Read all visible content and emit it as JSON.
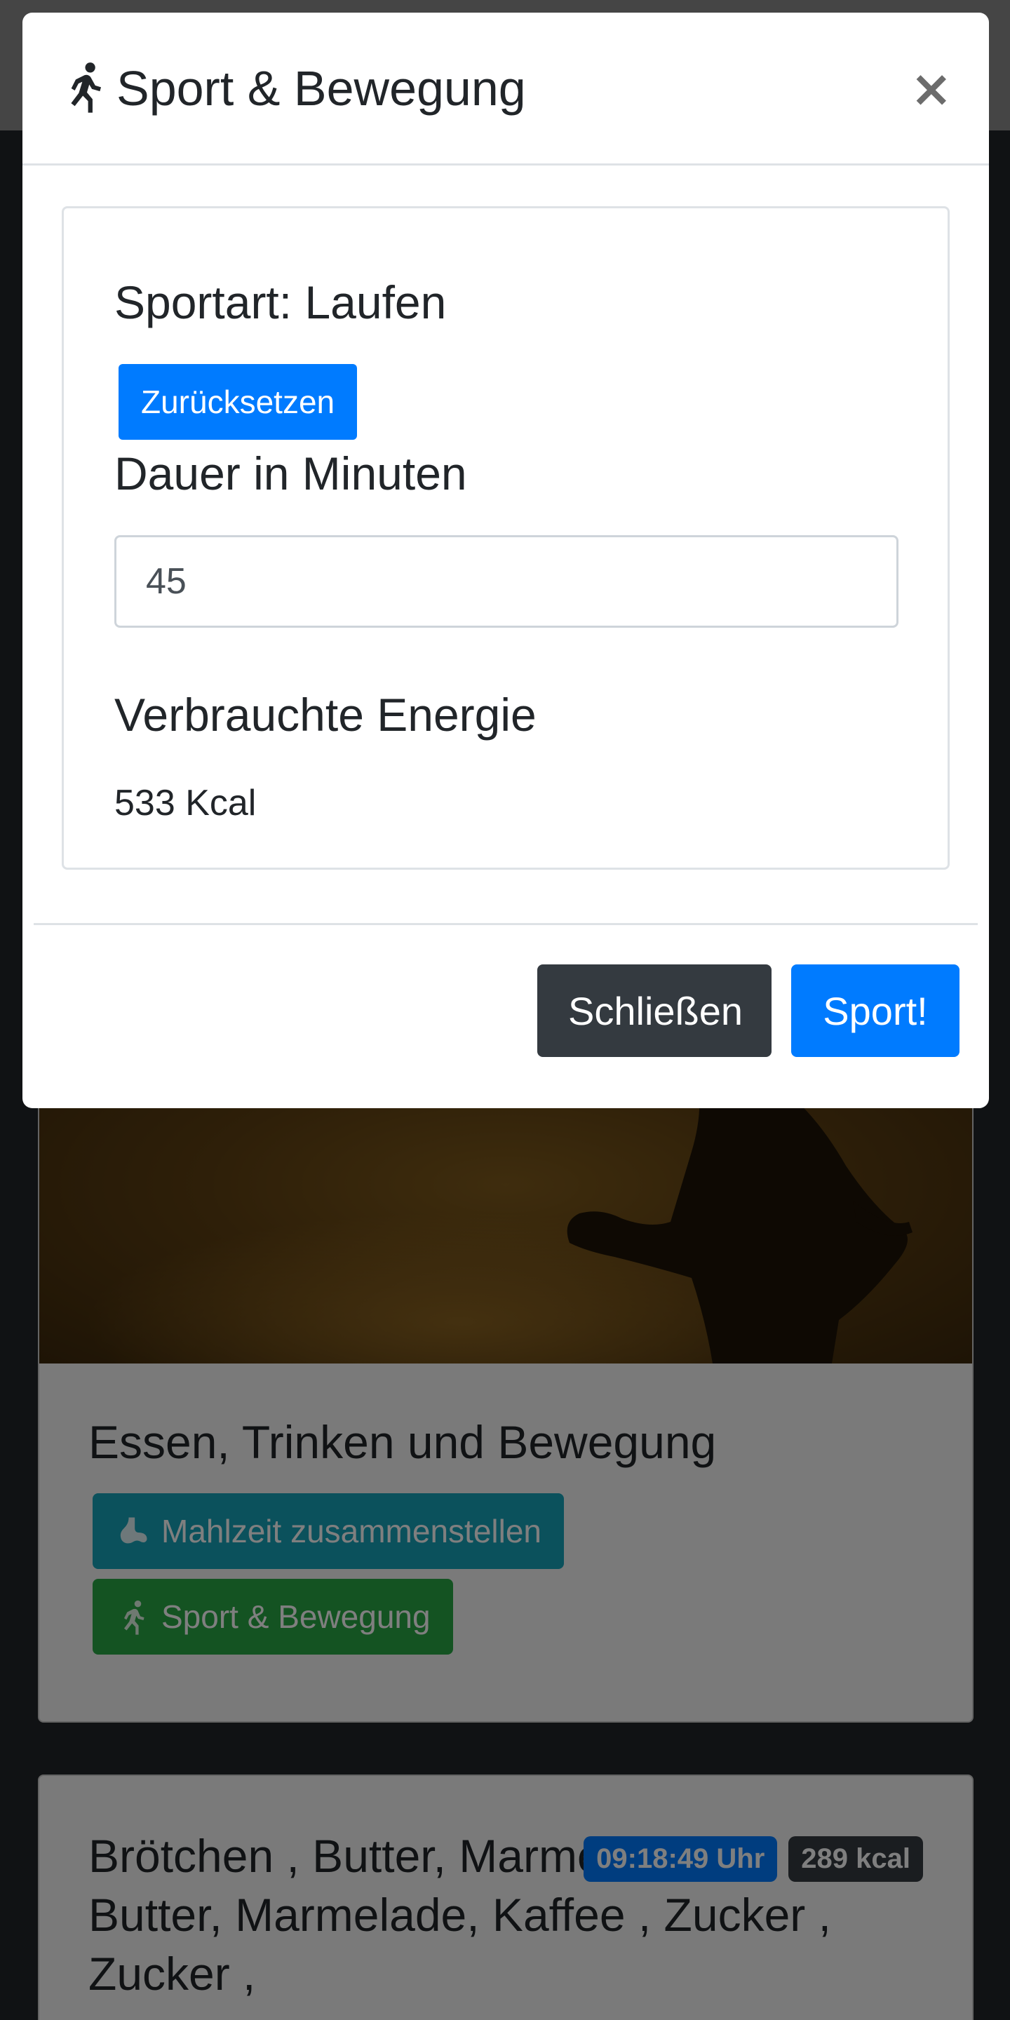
{
  "background": {
    "activity_card": {
      "title": "Essen, Trinken und Bewegung",
      "meal_button": {
        "label": "Mahlzeit zusammenstellen",
        "icon": "stomach-icon"
      },
      "sport_button": {
        "label": "Sport & Bewegung",
        "icon": "running-icon"
      }
    },
    "meal_entry": {
      "title": "Brötchen , Butter, Marmelade, Butter, Marmelade, Kaffee , Zucker , Zucker ,",
      "time_badge": "09:18:49 Uhr",
      "kcal_badge": "289 kcal"
    }
  },
  "modal": {
    "title": "Sport & Bewegung",
    "title_icon": "running-icon",
    "close_symbol": "×",
    "sport_label": "Sportart: Laufen",
    "reset_button": "Zurücksetzen",
    "duration_label": "Dauer in Minuten",
    "duration_value": "45",
    "energy_label": "Verbrauchte Energie",
    "energy_value": "533 Kcal",
    "close_button": "Schließen",
    "submit_button": "Sport!"
  },
  "colors": {
    "primary": "#007bff",
    "dark": "#343a40",
    "info": "#17a2b8",
    "success": "#28a745"
  }
}
